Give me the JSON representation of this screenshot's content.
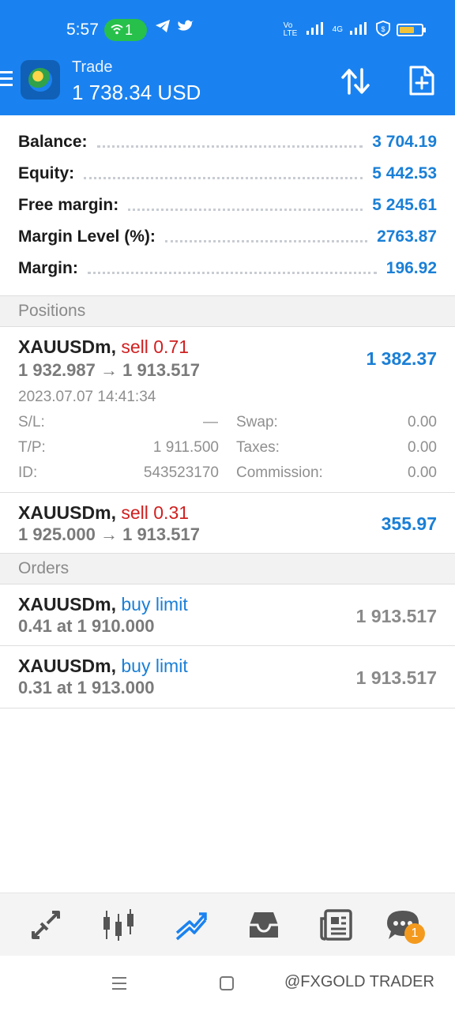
{
  "status_bar": {
    "time": "5:57",
    "hotspot_count": "1",
    "telegram_icon": "telegram-icon",
    "twitter_icon": "twitter-icon",
    "volte_label": "Vo LTE",
    "network_label": "4G",
    "battery_level": 0.7,
    "battery_color": "#f2c33a"
  },
  "app_bar": {
    "title": "Trade",
    "balance": "1 738.34 USD",
    "accent": "#1a82f0"
  },
  "summary": [
    {
      "label": "Balance:",
      "value": "3 704.19"
    },
    {
      "label": "Equity:",
      "value": "5 442.53"
    },
    {
      "label": "Free margin:",
      "value": "5 245.61"
    },
    {
      "label": "Margin Level (%):",
      "value": "2763.87"
    },
    {
      "label": "Margin:",
      "value": "196.92"
    }
  ],
  "positions": {
    "header": "Positions",
    "items": [
      {
        "symbol": "XAUUSDm,",
        "side": "sell 0.71",
        "prices": "1 932.987 → 1 913.517",
        "profit": "1 382.37",
        "time": "2023.07.07 14:41:34",
        "sl_label": "S/L:",
        "sl_value": "—",
        "tp_label": "T/P:",
        "tp_value": "1 911.500",
        "id_label": "ID:",
        "id_value": "543523170",
        "swap_label": "Swap:",
        "swap_value": "0.00",
        "taxes_label": "Taxes:",
        "taxes_value": "0.00",
        "commission_label": "Commission:",
        "commission_value": "0.00"
      },
      {
        "symbol": "XAUUSDm,",
        "side": "sell 0.31",
        "prices": "1 925.000 → 1 913.517",
        "profit": "355.97"
      }
    ]
  },
  "orders": {
    "header": "Orders",
    "items": [
      {
        "symbol": "XAUUSDm,",
        "type": "buy limit",
        "detail": "0.41 at 1 910.000",
        "price": "1 913.517"
      },
      {
        "symbol": "XAUUSDm,",
        "type": "buy limit",
        "detail": "0.31 at 1 913.000",
        "price": "1 913.517"
      }
    ]
  },
  "bottom_nav": {
    "items": [
      "quotes-icon",
      "chart-icon",
      "trade-icon",
      "history-icon",
      "news-icon",
      "chat-icon"
    ],
    "active": "trade-icon",
    "chat_badge": "1"
  },
  "watermark": "@FXGOLD TRADER"
}
